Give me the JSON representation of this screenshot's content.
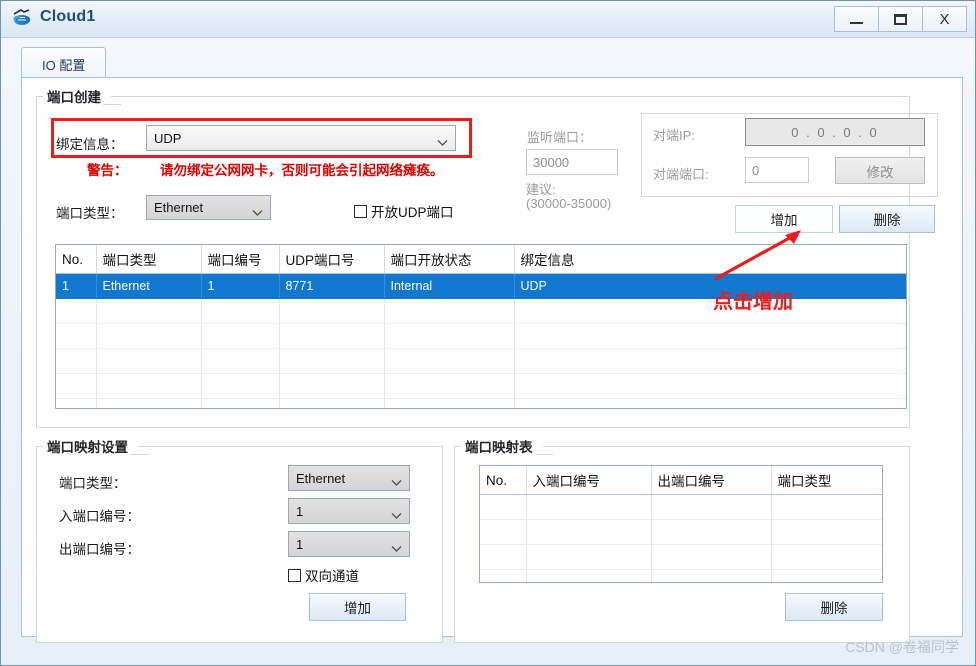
{
  "window": {
    "title": "Cloud1",
    "icon": "cloud-icon",
    "controls": {
      "minimize": "–",
      "maximize": "□",
      "close": "X"
    }
  },
  "tabs": [
    {
      "label": "IO 配置",
      "active": true
    }
  ],
  "port_create": {
    "group_title": "端口创建",
    "bind_label": "绑定信息：",
    "bind_value": "UDP",
    "warn_label": "警告：",
    "warn_text": "请勿绑定公网网卡，否则可能会引起网络瘫痪。",
    "port_type_label": "端口类型：",
    "port_type_value": "Ethernet",
    "open_udp_label": "开放UDP端口",
    "open_udp_checked": false,
    "listen_port_label": "监听端口：",
    "listen_port_value": "30000",
    "suggest_label": "建议:",
    "suggest_range": "(30000-35000)",
    "peer_ip_label": "对端IP:",
    "peer_ip_value": "0 . 0 . 0 . 0",
    "peer_port_label": "对端端口:",
    "peer_port_value": "0",
    "modify_button": "修改",
    "add_button": "增加",
    "delete_button": "删除",
    "table": {
      "columns": [
        "No.",
        "端口类型",
        "端口编号",
        "UDP端口号",
        "端口开放状态",
        "绑定信息"
      ],
      "rows": [
        {
          "no": "1",
          "port_type": "Ethernet",
          "port_no": "1",
          "udp_port": "8771",
          "open_state": "Internal",
          "bind_info": "UDP",
          "selected": true
        }
      ],
      "empty_rows": 7
    }
  },
  "port_map_settings": {
    "group_title": "端口映射设置",
    "port_type_label": "端口类型：",
    "port_type_value": "Ethernet",
    "in_port_label": "入端口编号：",
    "in_port_value": "1",
    "out_port_label": "出端口编号：",
    "out_port_value": "1",
    "bidirectional_label": "双向通道",
    "bidirectional_checked": false,
    "add_button": "增加"
  },
  "port_map_table": {
    "group_title": "端口映射表",
    "columns": [
      "No.",
      "入端口编号",
      "出端口编号",
      "端口类型"
    ],
    "rows": [],
    "empty_rows": 5,
    "delete_button": "删除"
  },
  "annotations": {
    "highlight_color": "#ee1c1c",
    "arrow_label": "点击增加"
  },
  "watermark": "CSDN @卷福同学"
}
